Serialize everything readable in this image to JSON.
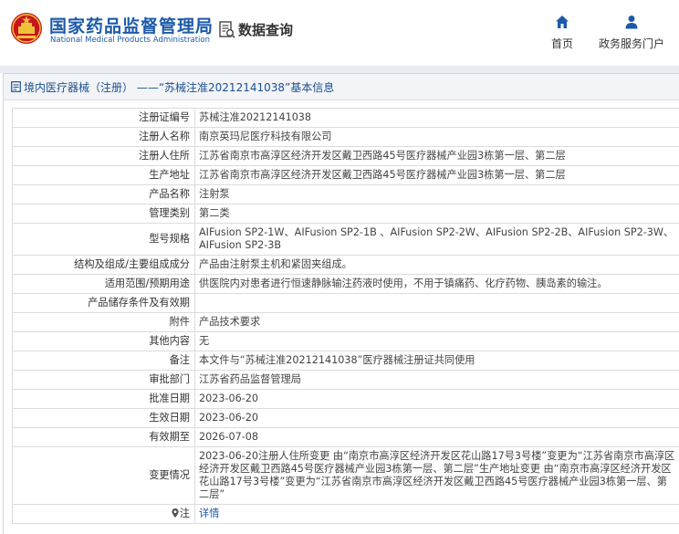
{
  "header": {
    "brand_cn": "国家药品监督管理局",
    "brand_en": "National Medical Products Administration",
    "data_query": "数据查询",
    "nav": [
      {
        "label": "首页",
        "icon": "home-icon"
      },
      {
        "label": "政务服务门户",
        "icon": "user-icon"
      }
    ]
  },
  "breadcrumb": "境内医疗器械（注册） ——“苏械注准20212141038”基本信息",
  "rows": [
    {
      "label": "注册证编号",
      "value": "苏械注准20212141038"
    },
    {
      "label": "注册人名称",
      "value": "南京英玛尼医疗科技有限公司"
    },
    {
      "label": "注册人住所",
      "value": "江苏省南京市高淳区经济开发区戴卫西路45号医疗器械产业园3栋第一层、第二层"
    },
    {
      "label": "生产地址",
      "value": "江苏省南京市高淳区经济开发区戴卫西路45号医疗器械产业园3栋第一层、第二层"
    },
    {
      "label": "产品名称",
      "value": "注射泵"
    },
    {
      "label": "管理类别",
      "value": "第二类"
    },
    {
      "label": "型号规格",
      "value": "AIFusion SP2-1W、AIFusion SP2-1B 、AIFusion SP2-2W、AIFusion SP2-2B、AIFusion SP2-3W、AIFusion SP2-3B"
    },
    {
      "label": "结构及组成/主要组成成分",
      "value": "产品由注射泵主机和紧固夹组成。"
    },
    {
      "label": "适用范围/预期用途",
      "value": "供医院内对患者进行恒速静脉输注药液时使用，不用于镇痛药、化疗药物、胰岛素的输注。"
    },
    {
      "label": "产品储存条件及有效期",
      "value": ""
    },
    {
      "label": "附件",
      "value": "产品技术要求"
    },
    {
      "label": "其他内容",
      "value": "无"
    },
    {
      "label": "备注",
      "value": "本文件与“苏械注准20212141038”医疗器械注册证共同使用"
    },
    {
      "label": "审批部门",
      "value": "江苏省药品监督管理局"
    },
    {
      "label": "批准日期",
      "value": "2023-06-20"
    },
    {
      "label": "生效日期",
      "value": "2023-06-20"
    },
    {
      "label": "有效期至",
      "value": "2026-07-08"
    },
    {
      "label": "变更情况",
      "value": "2023-06-20注册人住所变更 由“南京市高淳区经济开发区花山路17号3号楼”变更为“江苏省南京市高淳区经济开发区戴卫西路45号医疗器械产业园3栋第一层、第二层”生产地址变更 由“南京市高淳区经济开发区花山路17号3号楼”变更为“江苏省南京市高淳区经济开发区戴卫西路45号医疗器械产业园3栋第一层、第二层”"
    }
  ],
  "note": {
    "label": "注",
    "link": "详情",
    "icon": "location-pin-icon"
  },
  "colors": {
    "brand": "#1c5aa8",
    "brand_red": "#c8161d",
    "gold": "#f0c23a"
  }
}
